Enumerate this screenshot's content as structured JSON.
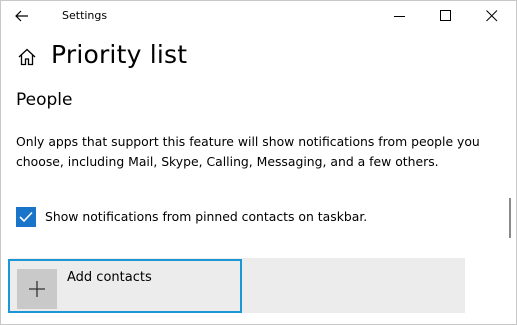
{
  "window": {
    "title": "Settings"
  },
  "page": {
    "title": "Priority list"
  },
  "section": {
    "title": "People",
    "description": "Only apps that support this feature will show notifications from people you choose, including Mail, Skype, Calling, Messaging, and a few others."
  },
  "pinned_checkbox": {
    "label": "Show notifications from pinned contacts on taskbar.",
    "checked": true
  },
  "add_contacts": {
    "label": "Add contacts"
  },
  "colors": {
    "accent": "#1a74c9",
    "focus_border": "#1c97d6",
    "tile_background": "#c9c9c9",
    "row_background": "#ececec"
  },
  "icons": {
    "back": "back-arrow-icon",
    "home": "home-icon",
    "minimize": "minimize-icon",
    "maximize": "maximize-icon",
    "close": "close-icon",
    "check": "checkmark-icon",
    "plus": "plus-icon"
  }
}
